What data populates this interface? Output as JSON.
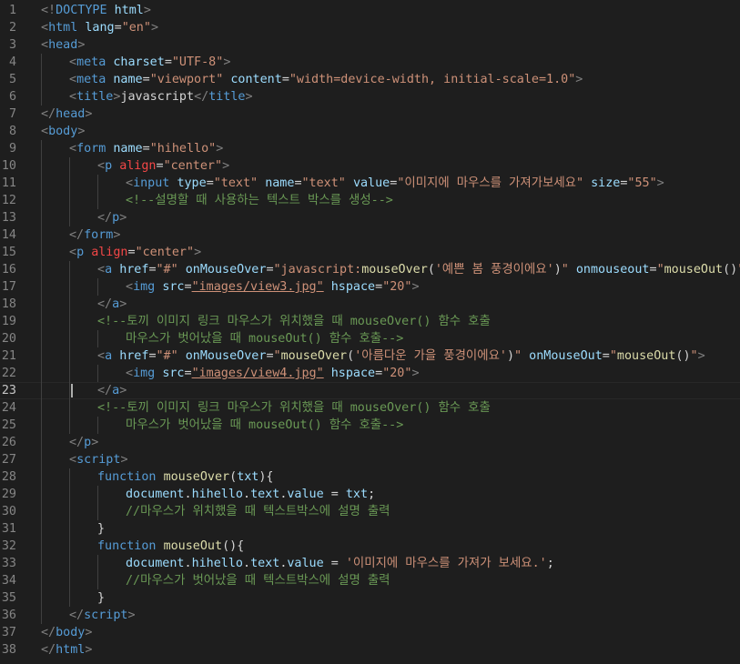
{
  "editor": {
    "active_line": 23,
    "colors": {
      "background": "#1e1e1e",
      "tag": "#569cd6",
      "attribute": "#9cdcfe",
      "string": "#ce9178",
      "comment": "#6a9955",
      "function": "#dcdcaa",
      "punctuation": "#808080",
      "line_number": "#858585"
    },
    "lines": [
      {
        "n": "1",
        "indent": 0,
        "t": [
          [
            "punct",
            "<!"
          ],
          [
            "tag",
            "DOCTYPE"
          ],
          [
            "text",
            " "
          ],
          [
            "attr",
            "html"
          ],
          [
            "punct",
            ">"
          ]
        ]
      },
      {
        "n": "2",
        "indent": 0,
        "t": [
          [
            "punct",
            "<"
          ],
          [
            "tag",
            "html"
          ],
          [
            "text",
            " "
          ],
          [
            "attr",
            "lang"
          ],
          [
            "text",
            "="
          ],
          [
            "str",
            "\"en\""
          ],
          [
            "punct",
            ">"
          ]
        ]
      },
      {
        "n": "3",
        "indent": 0,
        "t": [
          [
            "punct",
            "<"
          ],
          [
            "tag",
            "head"
          ],
          [
            "punct",
            ">"
          ]
        ]
      },
      {
        "n": "4",
        "indent": 1,
        "t": [
          [
            "punct",
            "<"
          ],
          [
            "tag",
            "meta"
          ],
          [
            "text",
            " "
          ],
          [
            "attr",
            "charset"
          ],
          [
            "text",
            "="
          ],
          [
            "str",
            "\"UTF-8\""
          ],
          [
            "punct",
            ">"
          ]
        ]
      },
      {
        "n": "5",
        "indent": 1,
        "t": [
          [
            "punct",
            "<"
          ],
          [
            "tag",
            "meta"
          ],
          [
            "text",
            " "
          ],
          [
            "attr",
            "name"
          ],
          [
            "text",
            "="
          ],
          [
            "str",
            "\"viewport\""
          ],
          [
            "text",
            " "
          ],
          [
            "attr",
            "content"
          ],
          [
            "text",
            "="
          ],
          [
            "str",
            "\"width=device-width, initial-scale=1.0\""
          ],
          [
            "punct",
            ">"
          ]
        ]
      },
      {
        "n": "6",
        "indent": 1,
        "t": [
          [
            "punct",
            "<"
          ],
          [
            "tag",
            "title"
          ],
          [
            "punct",
            ">"
          ],
          [
            "text",
            "javascript"
          ],
          [
            "punct",
            "</"
          ],
          [
            "tag",
            "title"
          ],
          [
            "punct",
            ">"
          ]
        ]
      },
      {
        "n": "7",
        "indent": 0,
        "t": [
          [
            "punct",
            "</"
          ],
          [
            "tag",
            "head"
          ],
          [
            "punct",
            ">"
          ]
        ]
      },
      {
        "n": "8",
        "indent": 0,
        "t": [
          [
            "punct",
            "<"
          ],
          [
            "tag",
            "body"
          ],
          [
            "punct",
            ">"
          ]
        ]
      },
      {
        "n": "9",
        "indent": 1,
        "t": [
          [
            "punct",
            "<"
          ],
          [
            "tag",
            "form"
          ],
          [
            "text",
            " "
          ],
          [
            "attr",
            "name"
          ],
          [
            "text",
            "="
          ],
          [
            "str",
            "\"hihello\""
          ],
          [
            "punct",
            ">"
          ]
        ]
      },
      {
        "n": "10",
        "indent": 2,
        "t": [
          [
            "punct",
            "<"
          ],
          [
            "tag",
            "p"
          ],
          [
            "text",
            " "
          ],
          [
            "err",
            "align"
          ],
          [
            "text",
            "="
          ],
          [
            "str",
            "\"center\""
          ],
          [
            "punct",
            ">"
          ]
        ]
      },
      {
        "n": "11",
        "indent": 3,
        "t": [
          [
            "punct",
            "<"
          ],
          [
            "tag",
            "input"
          ],
          [
            "text",
            " "
          ],
          [
            "attr",
            "type"
          ],
          [
            "text",
            "="
          ],
          [
            "str",
            "\"text\""
          ],
          [
            "text",
            " "
          ],
          [
            "attr",
            "name"
          ],
          [
            "text",
            "="
          ],
          [
            "str",
            "\"text\""
          ],
          [
            "text",
            " "
          ],
          [
            "attr",
            "value"
          ],
          [
            "text",
            "="
          ],
          [
            "str",
            "\"이미지에 마우스를 가져가보세요\""
          ],
          [
            "text",
            " "
          ],
          [
            "attr",
            "size"
          ],
          [
            "text",
            "="
          ],
          [
            "str",
            "\"55\""
          ],
          [
            "punct",
            ">"
          ]
        ]
      },
      {
        "n": "12",
        "indent": 3,
        "t": [
          [
            "comment",
            "<!--설명할 때 사용하는 텍스트 박스를 생성-->"
          ]
        ]
      },
      {
        "n": "13",
        "indent": 2,
        "t": [
          [
            "punct",
            "</"
          ],
          [
            "tag",
            "p"
          ],
          [
            "punct",
            ">"
          ]
        ]
      },
      {
        "n": "14",
        "indent": 1,
        "t": [
          [
            "punct",
            "</"
          ],
          [
            "tag",
            "form"
          ],
          [
            "punct",
            ">"
          ]
        ]
      },
      {
        "n": "15",
        "indent": 1,
        "t": [
          [
            "punct",
            "<"
          ],
          [
            "tag",
            "p"
          ],
          [
            "text",
            " "
          ],
          [
            "err",
            "align"
          ],
          [
            "text",
            "="
          ],
          [
            "str",
            "\"center\""
          ],
          [
            "punct",
            ">"
          ]
        ]
      },
      {
        "n": "16",
        "indent": 2,
        "t": [
          [
            "punct",
            "<"
          ],
          [
            "tag",
            "a"
          ],
          [
            "text",
            " "
          ],
          [
            "attr",
            "href"
          ],
          [
            "text",
            "="
          ],
          [
            "str",
            "\"#\""
          ],
          [
            "text",
            " "
          ],
          [
            "attr",
            "onMouseOver"
          ],
          [
            "text",
            "="
          ],
          [
            "str",
            "\"javascript:"
          ],
          [
            "fn",
            "mouseOver"
          ],
          [
            "text",
            "("
          ],
          [
            "str",
            "'예쁜 봄 풍경이에요'"
          ],
          [
            "text",
            ")"
          ],
          [
            "str",
            "\""
          ],
          [
            "text",
            " "
          ],
          [
            "attr",
            "onmouseout"
          ],
          [
            "text",
            "="
          ],
          [
            "str",
            "\""
          ],
          [
            "fn",
            "mouseOut"
          ],
          [
            "text",
            "()"
          ],
          [
            "str",
            "\""
          ],
          [
            "punct",
            ">"
          ]
        ]
      },
      {
        "n": "17",
        "indent": 3,
        "t": [
          [
            "punct",
            "<"
          ],
          [
            "tag",
            "img"
          ],
          [
            "text",
            " "
          ],
          [
            "attr",
            "src"
          ],
          [
            "text",
            "="
          ],
          [
            "link",
            "\"images/view3.jpg\""
          ],
          [
            "text",
            " "
          ],
          [
            "attr",
            "hspace"
          ],
          [
            "text",
            "="
          ],
          [
            "str",
            "\"20\""
          ],
          [
            "punct",
            ">"
          ]
        ]
      },
      {
        "n": "18",
        "indent": 2,
        "t": [
          [
            "punct",
            "</"
          ],
          [
            "tag",
            "a"
          ],
          [
            "punct",
            ">"
          ]
        ]
      },
      {
        "n": "19",
        "indent": 2,
        "t": [
          [
            "comment",
            "<!--토끼 이미지 링크 마우스가 위치했을 때 mouseOver() 함수 호출"
          ]
        ]
      },
      {
        "n": "20",
        "indent": 3,
        "t": [
          [
            "comment",
            "마우스가 벗어났을 때 mouseOut() 함수 호출-->"
          ]
        ]
      },
      {
        "n": "21",
        "indent": 2,
        "t": [
          [
            "punct",
            "<"
          ],
          [
            "tag",
            "a"
          ],
          [
            "text",
            " "
          ],
          [
            "attr",
            "href"
          ],
          [
            "text",
            "="
          ],
          [
            "str",
            "\"#\""
          ],
          [
            "text",
            " "
          ],
          [
            "attr",
            "onMouseOver"
          ],
          [
            "text",
            "="
          ],
          [
            "str",
            "\""
          ],
          [
            "fn",
            "mouseOver"
          ],
          [
            "text",
            "("
          ],
          [
            "str",
            "'아름다운 가을 풍경이에요'"
          ],
          [
            "text",
            ")"
          ],
          [
            "str",
            "\""
          ],
          [
            "text",
            " "
          ],
          [
            "attr",
            "onMouseOut"
          ],
          [
            "text",
            "="
          ],
          [
            "str",
            "\""
          ],
          [
            "fn",
            "mouseOut"
          ],
          [
            "text",
            "()"
          ],
          [
            "str",
            "\""
          ],
          [
            "punct",
            ">"
          ]
        ]
      },
      {
        "n": "22",
        "indent": 3,
        "t": [
          [
            "punct",
            "<"
          ],
          [
            "tag",
            "img"
          ],
          [
            "text",
            " "
          ],
          [
            "attr",
            "src"
          ],
          [
            "text",
            "="
          ],
          [
            "link",
            "\"images/view4.jpg\""
          ],
          [
            "text",
            " "
          ],
          [
            "attr",
            "hspace"
          ],
          [
            "text",
            "="
          ],
          [
            "str",
            "\"20\""
          ],
          [
            "punct",
            ">"
          ]
        ]
      },
      {
        "n": "23",
        "indent": 2,
        "t": [
          [
            "punct",
            "</"
          ],
          [
            "tag",
            "a"
          ],
          [
            "punct",
            ">"
          ]
        ]
      },
      {
        "n": "24",
        "indent": 2,
        "t": [
          [
            "comment",
            "<!--토끼 이미지 링크 마우스가 위치했을 때 mouseOver() 함수 호출"
          ]
        ]
      },
      {
        "n": "25",
        "indent": 3,
        "t": [
          [
            "comment",
            "마우스가 벗어났을 때 mouseOut() 함수 호출-->"
          ]
        ]
      },
      {
        "n": "26",
        "indent": 1,
        "t": [
          [
            "punct",
            "</"
          ],
          [
            "tag",
            "p"
          ],
          [
            "punct",
            ">"
          ]
        ]
      },
      {
        "n": "27",
        "indent": 1,
        "t": [
          [
            "punct",
            "<"
          ],
          [
            "tag",
            "script"
          ],
          [
            "punct",
            ">"
          ]
        ]
      },
      {
        "n": "28",
        "indent": 2,
        "t": [
          [
            "kw",
            "function"
          ],
          [
            "text",
            " "
          ],
          [
            "fn",
            "mouseOver"
          ],
          [
            "text",
            "("
          ],
          [
            "var",
            "txt"
          ],
          [
            "text",
            "){"
          ]
        ]
      },
      {
        "n": "29",
        "indent": 3,
        "t": [
          [
            "var",
            "document"
          ],
          [
            "text",
            "."
          ],
          [
            "var",
            "hihello"
          ],
          [
            "text",
            "."
          ],
          [
            "var",
            "text"
          ],
          [
            "text",
            "."
          ],
          [
            "var",
            "value"
          ],
          [
            "text",
            " = "
          ],
          [
            "var",
            "txt"
          ],
          [
            "text",
            ";"
          ]
        ]
      },
      {
        "n": "30",
        "indent": 3,
        "t": [
          [
            "comment",
            "//마우스가 위치했을 때 텍스트박스에 설명 출력"
          ]
        ]
      },
      {
        "n": "31",
        "indent": 2,
        "t": [
          [
            "text",
            "}"
          ]
        ]
      },
      {
        "n": "32",
        "indent": 2,
        "t": [
          [
            "kw",
            "function"
          ],
          [
            "text",
            " "
          ],
          [
            "fn",
            "mouseOut"
          ],
          [
            "text",
            "(){"
          ]
        ]
      },
      {
        "n": "33",
        "indent": 3,
        "t": [
          [
            "var",
            "document"
          ],
          [
            "text",
            "."
          ],
          [
            "var",
            "hihello"
          ],
          [
            "text",
            "."
          ],
          [
            "var",
            "text"
          ],
          [
            "text",
            "."
          ],
          [
            "var",
            "value"
          ],
          [
            "text",
            " = "
          ],
          [
            "str",
            "'이미지에 마우스를 가져가 보세요.'"
          ],
          [
            "text",
            ";"
          ]
        ]
      },
      {
        "n": "34",
        "indent": 3,
        "t": [
          [
            "comment",
            "//마우스가 벗어났을 때 텍스트박스에 설명 출력"
          ]
        ]
      },
      {
        "n": "35",
        "indent": 2,
        "t": [
          [
            "text",
            "}"
          ]
        ]
      },
      {
        "n": "36",
        "indent": 1,
        "t": [
          [
            "punct",
            "</"
          ],
          [
            "tag",
            "script"
          ],
          [
            "punct",
            ">"
          ]
        ]
      },
      {
        "n": "37",
        "indent": 0,
        "t": [
          [
            "punct",
            "</"
          ],
          [
            "tag",
            "body"
          ],
          [
            "punct",
            ">"
          ]
        ]
      },
      {
        "n": "38",
        "indent": 0,
        "t": [
          [
            "punct",
            "</"
          ],
          [
            "tag",
            "html"
          ],
          [
            "punct",
            ">"
          ]
        ]
      }
    ]
  }
}
